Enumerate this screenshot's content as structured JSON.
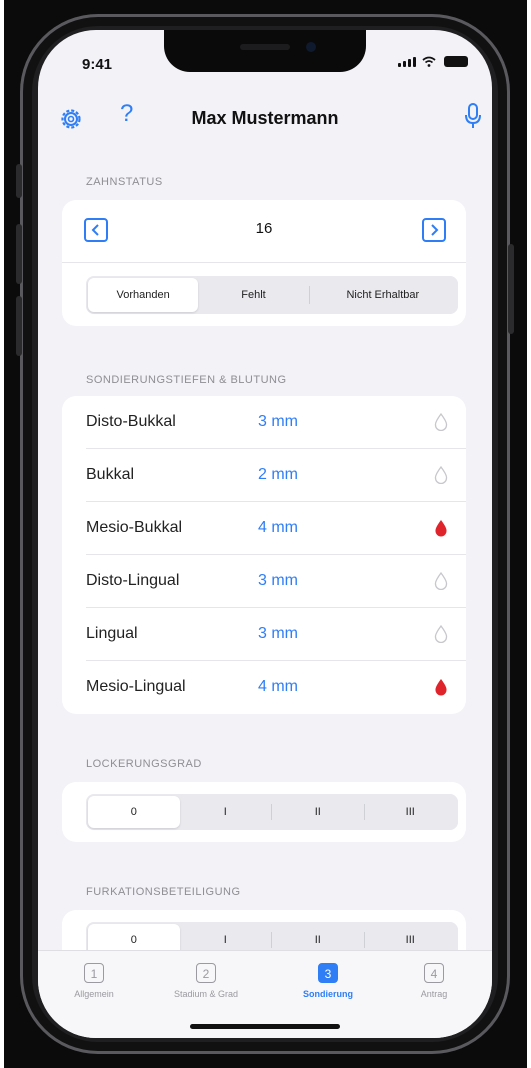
{
  "status_bar": {
    "time": "9:41"
  },
  "nav": {
    "title": "Max Mustermann",
    "help_label": "?"
  },
  "zahnstatus": {
    "header": "ZAHNSTATUS",
    "tooth_number": "16",
    "segments": [
      "Vorhanden",
      "Fehlt",
      "Nicht Erhaltbar"
    ],
    "selected": 0
  },
  "sondierung": {
    "header": "SONDIERUNGSTIEFEN & BLUTUNG",
    "rows": [
      {
        "label": "Disto-Bukkal",
        "value": "3 mm",
        "bleeding": false
      },
      {
        "label": "Bukkal",
        "value": "2 mm",
        "bleeding": false
      },
      {
        "label": "Mesio-Bukkal",
        "value": "4 mm",
        "bleeding": true
      },
      {
        "label": "Disto-Lingual",
        "value": "3 mm",
        "bleeding": false
      },
      {
        "label": "Lingual",
        "value": "3 mm",
        "bleeding": false
      },
      {
        "label": "Mesio-Lingual",
        "value": "4 mm",
        "bleeding": true
      }
    ]
  },
  "lockerungsgrad": {
    "header": "LOCKERUNGSGRAD",
    "segments": [
      "0",
      "I",
      "II",
      "III"
    ],
    "selected": 0
  },
  "furkation": {
    "header": "FURKATIONSBETEILIGUNG",
    "segments": [
      "0",
      "I",
      "II",
      "III"
    ],
    "selected": 0
  },
  "tabs": [
    {
      "number": "1",
      "label": "Allgemein",
      "active": false
    },
    {
      "number": "2",
      "label": "Stadium & Grad",
      "active": false
    },
    {
      "number": "3",
      "label": "Sondierung",
      "active": true
    },
    {
      "number": "4",
      "label": "Antrag",
      "active": false
    }
  ],
  "colors": {
    "accent": "#2f7ef5",
    "bleeding": "#e0242b",
    "background": "#f2f2f7"
  }
}
